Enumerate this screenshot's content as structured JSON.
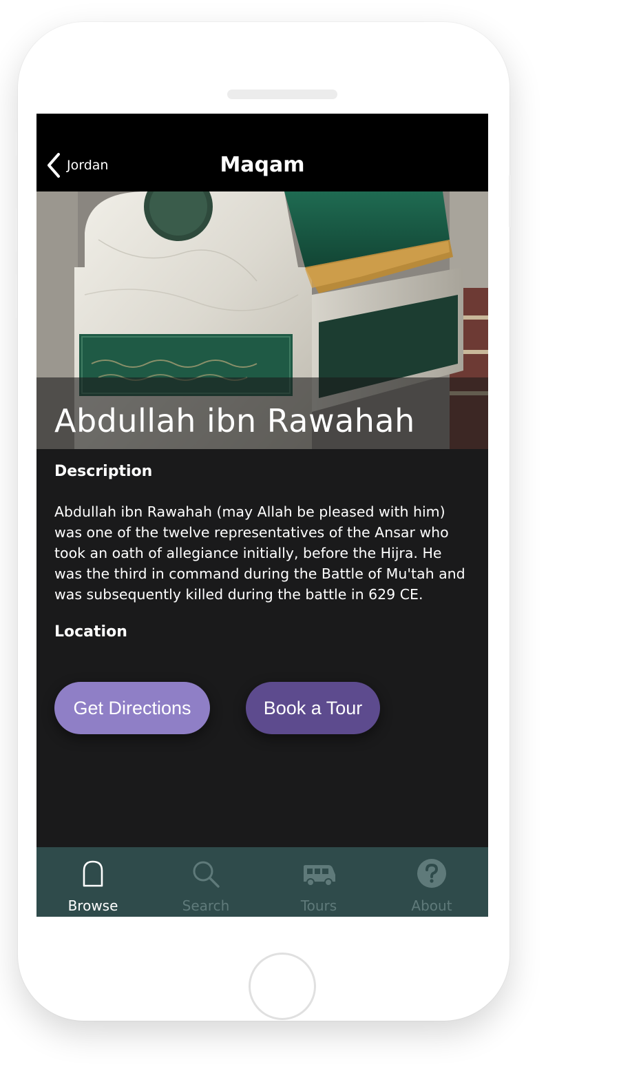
{
  "nav": {
    "back_label": "Jordan",
    "title": "Maqam"
  },
  "hero": {
    "title": "Abdullah ibn Rawahah"
  },
  "description": {
    "heading": "Description",
    "text": "Abdullah ibn Rawahah (may Allah be pleased with him) was one of the twelve representatives of the Ansar who took an oath of allegiance initially, before the Hijra. He was the third in command during the Battle of Mu'tah and was subsequently killed during the battle in 629 CE."
  },
  "location": {
    "heading": "Location",
    "directions_label": "Get Directions",
    "tour_label": "Book a Tour"
  },
  "tabs": [
    {
      "label": "Browse",
      "icon": "arch-icon",
      "active": true
    },
    {
      "label": "Search",
      "icon": "search-icon",
      "active": false
    },
    {
      "label": "Tours",
      "icon": "van-icon",
      "active": false
    },
    {
      "label": "About",
      "icon": "question-icon",
      "active": false
    }
  ],
  "colors": {
    "navbar": "#000000",
    "screen_bg": "#1a1a1b",
    "tabbar": "#2f4b4b",
    "tab_active": "#ffffff",
    "tab_inactive": "#5f7a7a",
    "button_directions": "#8f7fc6",
    "button_tour": "#5d4b8e"
  }
}
